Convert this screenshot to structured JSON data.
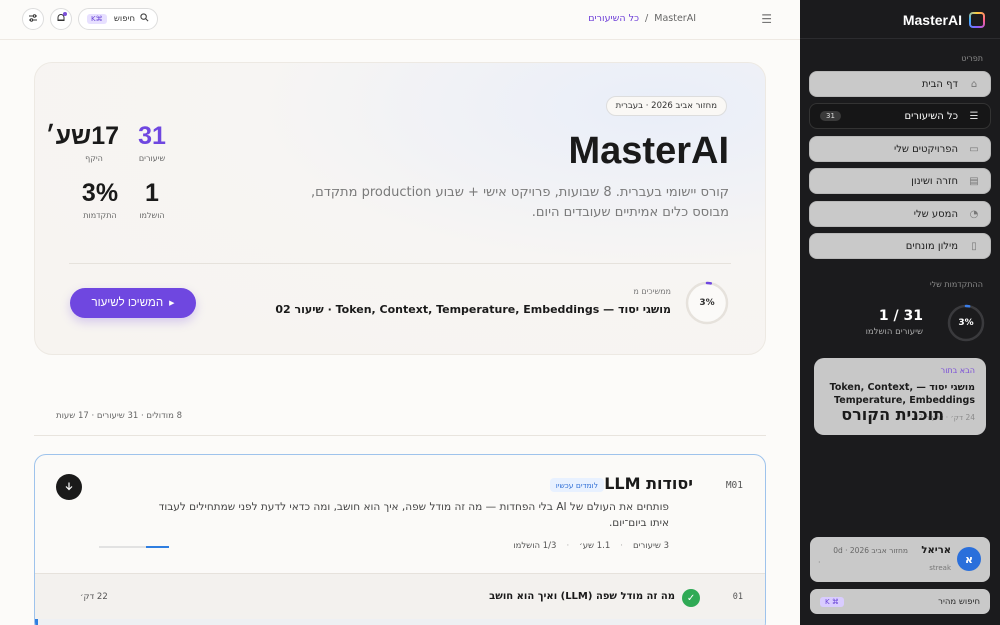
{
  "brand": {
    "name": "MasterAI"
  },
  "sidebar": {
    "menu_section": "תפריט",
    "items": [
      {
        "label": "דף הבית",
        "icon": "home-icon",
        "glyph": "⌂"
      },
      {
        "label": "כל השיעורים",
        "icon": "list-icon",
        "glyph": "☰",
        "badge": "31",
        "active": true
      },
      {
        "label": "הפרויקטים שלי",
        "icon": "folder-icon",
        "glyph": "▭"
      },
      {
        "label": "חזרה ושינון",
        "icon": "cards-icon",
        "glyph": "▤"
      },
      {
        "label": "המסע שלי",
        "icon": "clock-icon",
        "glyph": "◔"
      },
      {
        "label": "מילון מונחים",
        "icon": "book-icon",
        "glyph": "▯"
      }
    ],
    "progress_section": "ההתקדמות שלי",
    "progress": {
      "count": "1 / 31",
      "label": "שיעורים הושלמו",
      "percent_text": "3%",
      "percent": 3
    },
    "next": {
      "label": "הבא בתור",
      "title": "מושגי יסוד — Token, Context, Temperature, Embeddings",
      "meta": "24 דק׳ · שיעור 02"
    },
    "user": {
      "avatar": "א",
      "name": "אריאל",
      "cohort": "מחזור אביב 2026 · 0d",
      "streak": "streak",
      "dot": "·"
    },
    "quick_search": {
      "label": "חיפוש מהיר",
      "kbd": "K ⌘"
    }
  },
  "topbar": {
    "breadcrumb": {
      "root": "MasterAI",
      "sep": "/",
      "current": "כל השיעורים"
    },
    "search": {
      "label": "חיפוש",
      "kbd": "K⌘"
    }
  },
  "hero": {
    "cohort": "מחזור אביב 2026 · בעברית",
    "title": "MasterAI",
    "description": "קורס יישומי בעברית. 8 שבועות, פרויקט אישי + שבוע production מתקדם, מבוסס כלים אמיתיים שעובדים היום.",
    "stats": [
      {
        "value": "31",
        "label": "שיעורים"
      },
      {
        "value": "17שע׳",
        "label": "היקף"
      },
      {
        "value": "1",
        "label": "הושלמו"
      },
      {
        "value": "3%",
        "label": "התקדמות"
      }
    ],
    "continue": {
      "label": "ממשיכים מ",
      "title": "מושגי יסוד — Token, Context, Temperature, Embeddings · שיעור 02",
      "percent_text": "3%",
      "percent": 3,
      "cta": "המשיכו לשיעור"
    }
  },
  "plan": {
    "title": "תוכנית הקורס",
    "meta": "8 מודולים · 31 שיעורים · 17 שעות",
    "module": {
      "num": "M01",
      "title": "יסודות LLM",
      "badge": "לומדים עכשיו",
      "description": "פותחים את העולם של AI בלי הפחדות — מה זה מודל שפה, איך הוא חושב, ומה כדאי לדעת לפני שמתחילים לעבוד איתו ביום־יום.",
      "stats": {
        "lessons": "3 שיעורים",
        "hours": "1.1 שע׳",
        "completed": "1/3 הושלמו"
      },
      "progress": 0.33,
      "lesson": {
        "num": "01",
        "title": "מה זה מודל שפה (LLM) ואיך הוא חושב",
        "duration": "22 דק׳"
      }
    }
  },
  "colors": {
    "accent": "#6f47e0",
    "success": "#2faa55",
    "link": "#2f7ee0"
  }
}
